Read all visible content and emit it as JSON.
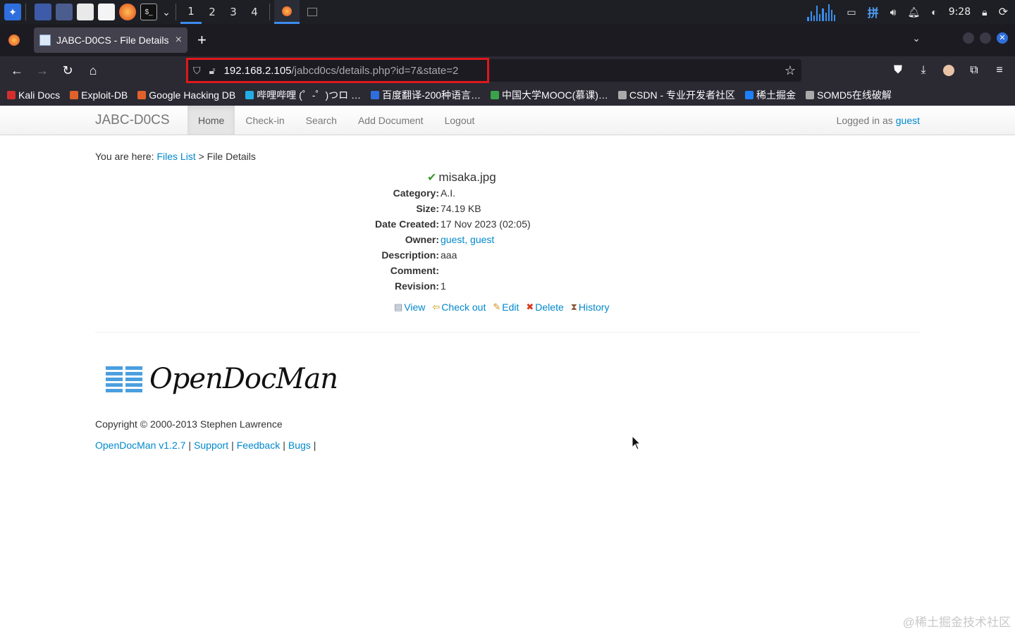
{
  "taskbar": {
    "workspaces": [
      "1",
      "2",
      "3",
      "4"
    ],
    "clock": "9:28",
    "ime_label": "拼"
  },
  "browser": {
    "tab_title": "JABC-D0CS - File Details",
    "tab_close": "×",
    "new_tab": "+",
    "url_host": "192.168.2.105",
    "url_path": "/jabcd0cs/details.php?id=7&state=2",
    "bookmarks": [
      {
        "label": "Kali Docs",
        "color": "#d32f2f"
      },
      {
        "label": "Exploit-DB",
        "color": "#e0622a"
      },
      {
        "label": "Google Hacking DB",
        "color": "#e0622a"
      },
      {
        "label": "哔哩哔哩 (゜-゜)つロ …",
        "color": "#23ade5"
      },
      {
        "label": "百度翻译-200种语言…",
        "color": "#2f6fdd"
      },
      {
        "label": "中国大学MOOC(慕课)…",
        "color": "#3aa34a"
      },
      {
        "label": "CSDN - 专业开发者社区",
        "color": "#aaaaaa"
      },
      {
        "label": "稀土掘金",
        "color": "#1e80ff"
      },
      {
        "label": "SOMD5在线破解",
        "color": "#aaaaaa"
      }
    ]
  },
  "site": {
    "brand": "JABC-D0CS",
    "menu": [
      "Home",
      "Check-in",
      "Search",
      "Add Document",
      "Logout"
    ],
    "logged_in_prefix": "Logged in as",
    "logged_in_user": "guest",
    "breadcrumb": {
      "prefix": "You are here:",
      "link": "Files List",
      "separator": ">",
      "current": "File Details"
    }
  },
  "file": {
    "name": "misaka.jpg",
    "fields": [
      {
        "label": "Category:",
        "value": "A.I.",
        "link": false
      },
      {
        "label": "Size:",
        "value": "74.19 KB",
        "link": false
      },
      {
        "label": "Date Created:",
        "value": "17 Nov 2023 (02:05)",
        "link": false
      },
      {
        "label": "Owner:",
        "value": "guest, guest",
        "link": true
      },
      {
        "label": "Description:",
        "value": "aaa",
        "link": false
      },
      {
        "label": "Comment:",
        "value": "",
        "link": false
      },
      {
        "label": "Revision:",
        "value": "1",
        "link": false
      }
    ],
    "actions": [
      {
        "label": "View",
        "icon": "view-icon"
      },
      {
        "label": "Check out",
        "icon": "checkout-icon"
      },
      {
        "label": "Edit",
        "icon": "edit-icon"
      },
      {
        "label": "Delete",
        "icon": "delete-icon"
      },
      {
        "label": "History",
        "icon": "history-icon"
      }
    ]
  },
  "footer": {
    "logo_text": "OpenDocMan",
    "copyright": "Copyright © 2000-2013 Stephen Lawrence",
    "links": [
      "OpenDocMan v1.2.7",
      "Support",
      "Feedback",
      "Bugs"
    ],
    "separator": "|"
  },
  "watermark": "@稀土掘金技术社区",
  "colors": {
    "link": "#0088cc",
    "url_highlight": "#e0171b",
    "check": "#3f9a2f"
  }
}
